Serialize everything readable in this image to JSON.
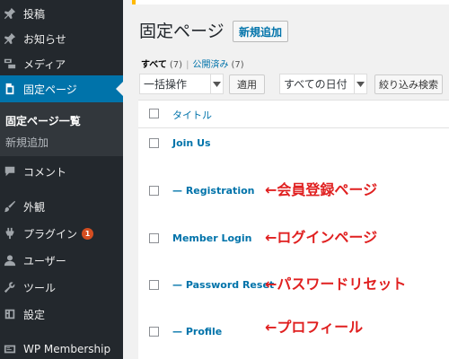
{
  "sidebar": {
    "items": [
      {
        "label": "投稿",
        "icon": "pin-icon"
      },
      {
        "label": "お知らせ",
        "icon": "pin-icon"
      },
      {
        "label": "メディア",
        "icon": "media-icon"
      },
      {
        "label": "固定ページ",
        "icon": "pages-icon"
      },
      {
        "label": "コメント",
        "icon": "comment-icon"
      },
      {
        "label": "外観",
        "icon": "brush-icon"
      },
      {
        "label": "プラグイン",
        "icon": "plugin-icon",
        "badge": "1"
      },
      {
        "label": "ユーザー",
        "icon": "user-icon"
      },
      {
        "label": "ツール",
        "icon": "wrench-icon"
      },
      {
        "label": "設定",
        "icon": "settings-icon"
      },
      {
        "label": "WP Membership",
        "icon": "membership-icon"
      }
    ],
    "submenu": {
      "current": "固定ページ一覧",
      "add_new": "新規追加"
    }
  },
  "header": {
    "title": "固定ページ",
    "add_new_label": "新規追加"
  },
  "filters": {
    "all_label": "すべて",
    "all_count": "(7)",
    "separator": "|",
    "published_label": "公開済み",
    "published_count": "(7)"
  },
  "toolbar": {
    "bulk_action_selected": "一括操作",
    "apply_label": "適用",
    "date_selected": "すべての日付",
    "filter_label": "絞り込み検索"
  },
  "table": {
    "header_title": "タイトル",
    "rows": [
      {
        "title": "Join Us",
        "annotation": ""
      },
      {
        "title": "— Registration",
        "annotation": "←会員登録ページ"
      },
      {
        "title": "Member Login",
        "annotation": "←ログインページ"
      },
      {
        "title": "— Password Reset",
        "annotation": "←パスワードリセット"
      },
      {
        "title": "— Profile",
        "annotation": "←プロフィール"
      }
    ]
  },
  "colors": {
    "sidebar_bg": "#23282d",
    "active_bg": "#0073aa",
    "link": "#0073aa",
    "annotation": "#e02020",
    "badge": "#d54e21"
  }
}
